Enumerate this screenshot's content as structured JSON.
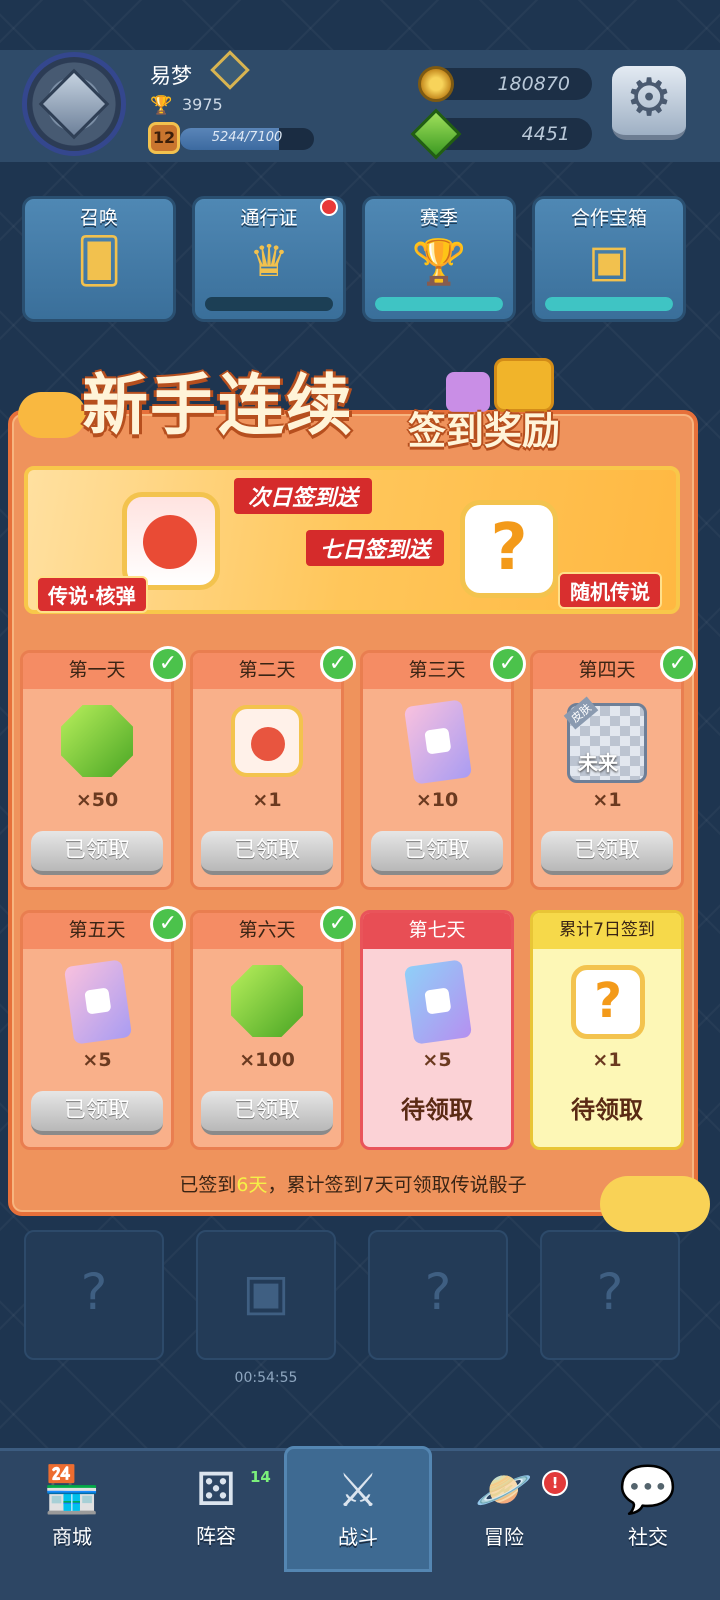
{
  "header": {
    "player_name": "易梦",
    "trophies": "3975",
    "level": "12",
    "xp_text": "5244/7100",
    "xp_fraction": 0.738,
    "gold": "180870",
    "gems": "4451"
  },
  "menu": [
    {
      "label": "召唤",
      "icon": "cards-icon",
      "bar": null
    },
    {
      "label": "通行证",
      "icon": "crown-badge-icon",
      "bar": 0.0
    },
    {
      "label": "赛季",
      "icon": "trophy-icon",
      "bar": 1.0
    },
    {
      "label": "合作宝箱",
      "icon": "chest-icon",
      "bar": 1.0
    }
  ],
  "modal": {
    "title_main": "新手连续",
    "title_sub": "签到奖励",
    "banner": {
      "ribbon_day2": "次日签到送",
      "ribbon_day7": "七日签到送",
      "tag_left": "传说·核弹",
      "tag_right": "随机传说"
    },
    "days": [
      {
        "label": "第一天",
        "item": "gem",
        "qty": "×50",
        "status": "已领取",
        "claimed": true
      },
      {
        "label": "第二天",
        "item": "nuke",
        "qty": "×1",
        "status": "已领取",
        "claimed": true
      },
      {
        "label": "第三天",
        "item": "dice-card",
        "qty": "×10",
        "status": "已领取",
        "claimed": true
      },
      {
        "label": "第四天",
        "item": "skin",
        "qty": "×1",
        "status": "已领取",
        "claimed": true,
        "skin_tag": "皮肤",
        "skin_name": "未来"
      },
      {
        "label": "第五天",
        "item": "dice-card",
        "qty": "×5",
        "status": "已领取",
        "claimed": true
      },
      {
        "label": "第六天",
        "item": "gem",
        "qty": "×100",
        "status": "已领取",
        "claimed": true
      },
      {
        "label": "第七天",
        "item": "dice-card",
        "qty": "×5",
        "status": "待领取",
        "claimed": false
      },
      {
        "label": "累计7日签到",
        "item": "mystery",
        "qty": "×1",
        "status": "待领取",
        "claimed": false
      }
    ],
    "footer_pre": "已签到",
    "footer_days": "6天",
    "footer_post": "，累计签到7天可领取传说骰子"
  },
  "chest_timer": "00:54:55",
  "nav": [
    {
      "label": "商城",
      "icon": "shop-icon"
    },
    {
      "label": "阵容",
      "icon": "dice-icon",
      "badge": "14"
    },
    {
      "label": "战斗",
      "icon": "swords-icon"
    },
    {
      "label": "冒险",
      "icon": "planet-icon",
      "badge": "!"
    },
    {
      "label": "社交",
      "icon": "chat-icon"
    }
  ],
  "colors": {
    "modal_bg": "#ef935c",
    "claimed_check": "#4bc24b",
    "highlight": "#f5f047"
  }
}
